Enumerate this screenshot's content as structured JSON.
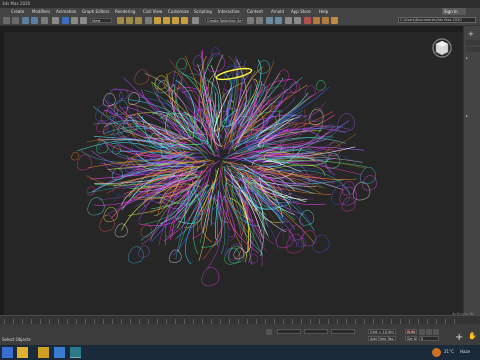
{
  "window": {
    "title": "3ds Max 2020"
  },
  "menu": [
    "Create",
    "Modifiers",
    "Animation",
    "Graph Editors",
    "Rendering",
    "Civil View",
    "Customize",
    "Scripting",
    "Interactive",
    "Content",
    "Arnold",
    "App Store",
    "Help"
  ],
  "account": {
    "label": "Sign In"
  },
  "toolbar": {
    "view_dropdown": "View",
    "selection_set": "Create Selection Se",
    "path": "C:\\Users\\Documents\\3ds Max 2020"
  },
  "status": {
    "selection": "Select Objects",
    "grid": "Grid = 10,0m",
    "add_time_tag": "Add Time Tag",
    "auto_key": "Auto Key",
    "set_key": "Set Key",
    "frame": "0"
  },
  "watermark": {
    "line1": "Activate W",
    "line2": "Go to Settin"
  },
  "tray": {
    "temperature": "21°C",
    "weather": "Haze"
  },
  "colors": {
    "viewport_bg": "#262626",
    "ui_bg": "#444444",
    "taskbar": "#1a2a3a",
    "accent": "#2a7fff"
  }
}
